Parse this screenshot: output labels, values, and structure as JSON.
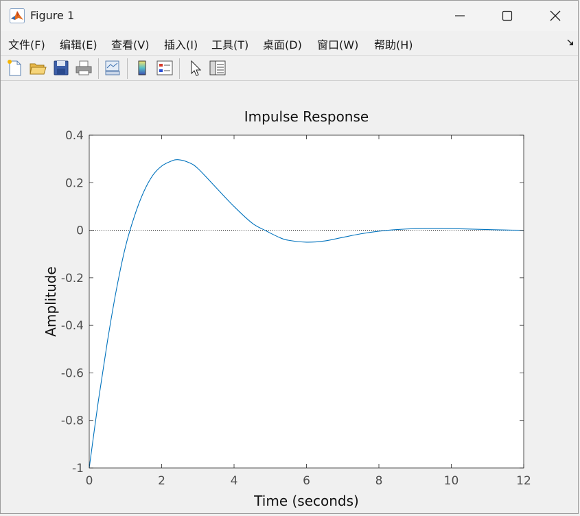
{
  "window": {
    "title": "Figure 1",
    "icon": "matlab-logo-icon",
    "controls": [
      "minimize-icon",
      "maximize-icon",
      "close-icon"
    ]
  },
  "menu": {
    "items": [
      "文件(F)",
      "编辑(E)",
      "查看(V)",
      "插入(I)",
      "工具(T)",
      "桌面(D)",
      "窗口(W)",
      "帮助(H)"
    ],
    "overflow_icon": "dock-arrow-icon"
  },
  "toolbar": {
    "buttons": [
      "new-figure-icon",
      "open-file-icon",
      "save-icon",
      "print-icon",
      "link-plot-icon",
      "colorbar-icon",
      "legend-icon",
      "select-pointer-icon",
      "property-editor-icon"
    ]
  },
  "colors": {
    "line": "#0072bd",
    "axes_border": "#262626",
    "tick_label": "#4d4d4d",
    "background": "#f0f0f0",
    "plot_bg": "#ffffff"
  },
  "chart_data": {
    "type": "line",
    "title": "Impulse Response",
    "xlabel": "Time (seconds)",
    "ylabel": "Amplitude",
    "xlim": [
      0,
      12
    ],
    "ylim": [
      -1,
      0.4
    ],
    "xticks": [
      "0",
      "2",
      "4",
      "6",
      "8",
      "10",
      "12"
    ],
    "yticks": [
      "-1",
      "-0.8",
      "-0.6",
      "-0.4",
      "-0.2",
      "0",
      "0.2",
      "0.4"
    ],
    "grid": false,
    "reference_line": {
      "y": 0,
      "style": "dotted"
    },
    "series": [
      {
        "x": [
          0,
          0.25,
          0.5,
          0.75,
          1.0,
          1.25,
          1.5,
          1.75,
          2.0,
          2.25,
          2.45,
          2.75,
          3.0,
          3.5,
          4.0,
          4.5,
          4.85,
          5.25,
          5.5,
          6.0,
          6.5,
          7.0,
          7.5,
          8.0,
          8.5,
          9.0,
          9.5,
          10.0,
          10.5,
          11.0,
          11.5,
          12.0
        ],
        "y": [
          -1.0,
          -0.72,
          -0.47,
          -0.25,
          -0.07,
          0.06,
          0.16,
          0.23,
          0.27,
          0.29,
          0.297,
          0.285,
          0.26,
          0.18,
          0.1,
          0.03,
          0.0,
          -0.03,
          -0.042,
          -0.05,
          -0.045,
          -0.03,
          -0.015,
          -0.004,
          0.003,
          0.007,
          0.008,
          0.007,
          0.005,
          0.003,
          0.001,
          0.0
        ]
      }
    ]
  }
}
